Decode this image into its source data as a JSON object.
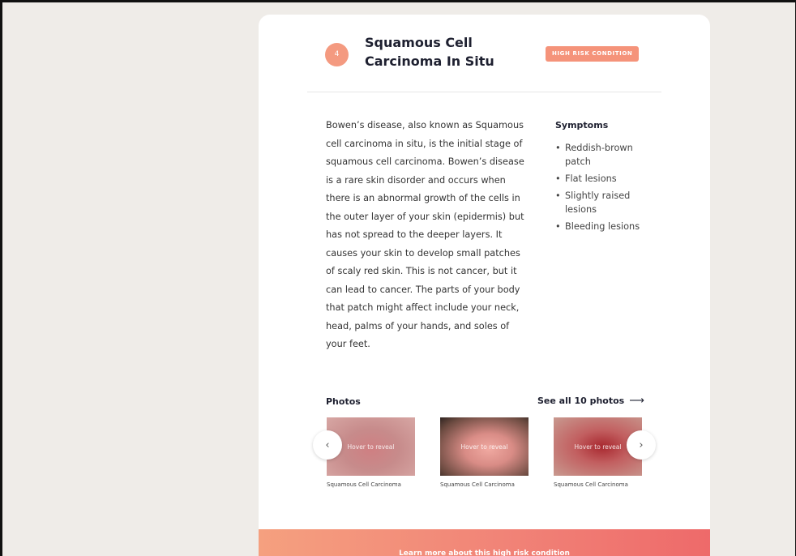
{
  "condition": {
    "number": "4",
    "title": "Squamous Cell Carcinoma In Situ",
    "risk_badge": "HIGH RISK CONDITION",
    "description": "Bowen’s disease, also known as Squamous cell carcinoma in situ, is the initial stage of squamous cell carcinoma. Bowen’s disease is a rare skin disorder and occurs when there is an abnormal growth of the cells in the outer layer of your skin (epidermis) but has not spread to the deeper layers. It causes your skin to develop small patches of scaly red skin. This is not cancer, but it can lead to cancer. The parts of your body that patch might affect include your neck, head, palms of your hands, and soles of your feet."
  },
  "symptoms": {
    "title": "Symptoms",
    "items": [
      "Reddish-brown patch",
      "Flat lesions",
      "Slightly raised lesions",
      "Bleeding lesions"
    ]
  },
  "photos": {
    "title": "Photos",
    "see_all": "See all 10 photos",
    "see_all_icon": "arrow-right-icon",
    "items": [
      {
        "overlay": "Hover to reveal",
        "caption": "Squamous Cell Carcinoma"
      },
      {
        "overlay": "Hover to reveal",
        "caption": "Squamous Cell Carcinoma"
      },
      {
        "overlay": "Hover to reveal",
        "caption": "Squamous Cell Carcinoma"
      }
    ],
    "prev_icon": "chevron-left-icon",
    "next_icon": "chevron-right-icon"
  },
  "cta": {
    "label": "Learn more about this high risk condition"
  },
  "colors": {
    "accent": "#f5937a",
    "page_background": "#efece8",
    "card_background": "#ffffff",
    "cta_gradient_start": "#f5a07f",
    "cta_gradient_end": "#ee6a6a"
  }
}
